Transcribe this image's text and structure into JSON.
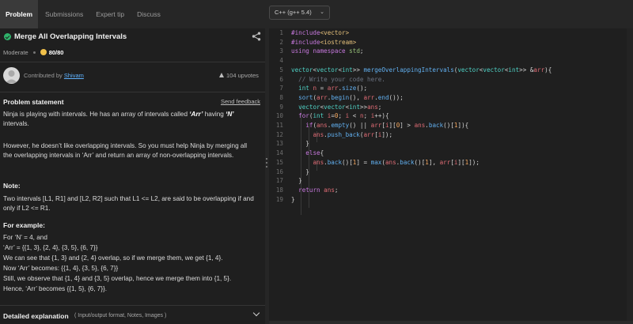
{
  "tabs": [
    "Problem",
    "Submissions",
    "Expert tip",
    "Discuss"
  ],
  "language": "C++ (g++ 5.4)",
  "problem": {
    "title": "Merge All Overlapping Intervals",
    "difficulty": "Moderate",
    "score": "80/80",
    "contributed_by_label": "Contributed by",
    "contributor": "Shivam",
    "upvotes": "104 upvotes",
    "statement_heading": "Problem statement",
    "send_feedback": "Send feedback",
    "para1_a": "Ninja is playing with intervals. He has an array of intervals called ",
    "para1_em1": "‘Arr’",
    "para1_b": " having ",
    "para1_em2": "‘N’",
    "para1_c": " intervals.",
    "para2": "However, he doesn’t like overlapping intervals. So you must help Ninja by merging all the overlapping intervals in ‘Arr’ and return an array of non-overlapping intervals.",
    "note_heading": "Note:",
    "note_text": "Two intervals [L1, R1] and [L2, R2] such that L1 <= L2, are said to be overlapping if and only if L2 <= R1.",
    "example_heading": "For example:",
    "example_lines": [
      "For ‘N’ = 4, and",
      "‘Arr’ = {{1, 3}, {2, 4}, {3, 5}, {6, 7}}",
      "We can see that {1, 3} and {2, 4} overlap, so if we merge them, we get {1, 4}.",
      "Now ‘Arr’ becomes: {{1, 4}, {3, 5}, {6, 7}}",
      "Still, we observe that {1, 4} and {3, 5} overlap, hence we merge them into {1, 5}.",
      "Hence, ‘Arr’ becomes {{1, 5}, {6, 7}}."
    ],
    "detail_heading": "Detailed explanation",
    "detail_sub": "( Input/output format, Notes, Images )"
  },
  "code": {
    "line_numbers": [
      "1",
      "2",
      "3",
      "4",
      "5",
      "6",
      "7",
      "8",
      "9",
      "10",
      "11",
      "12",
      "13",
      "14",
      "15",
      "16",
      "17",
      "18",
      "19"
    ],
    "lines": [
      "#include<vector>",
      "#include<iostream>",
      "using namespace std;",
      "",
      "vector<vector<int>> mergeOverlappingIntervals(vector<vector<int>> &arr){",
      "  // Write your code here.",
      "  int n = arr.size();",
      "  sort(arr.begin(), arr.end());",
      "  vector<vector<int>>ans;",
      "  for(int i=0; i < n; i++){",
      "    if(ans.empty() || arr[i][0] > ans.back()[1]){",
      "      ans.push_back(arr[i]);",
      "    }",
      "    else{",
      "      ans.back()[1] = max(ans.back()[1], arr[i][1]);",
      "    }",
      "  }",
      "  return ans;",
      "}"
    ]
  },
  "icons": {
    "solved": "check-circle-icon",
    "share": "share-icon",
    "coin": "coin-icon",
    "upvote": "upvote-icon",
    "dropdown": "chevron-down-icon"
  },
  "colors": {
    "accent_green": "#2fb36b",
    "link_blue": "#5fb3ff",
    "coin_yellow": "#f0c04a"
  }
}
